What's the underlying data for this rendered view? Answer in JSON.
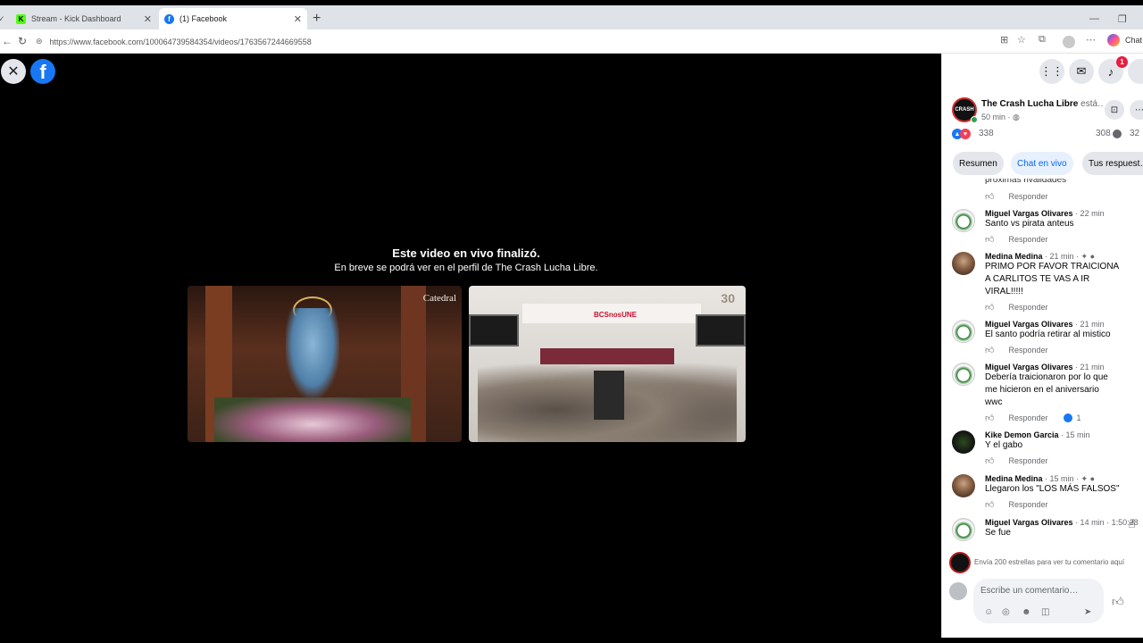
{
  "browser": {
    "tabs": [
      {
        "title": "Stream - Kick Dashboard",
        "active": false
      },
      {
        "title": "(1) Facebook",
        "active": true
      }
    ],
    "url": "https://www.facebook.com/100064739584354/videos/1763567244669558",
    "copilot_label": "Chat"
  },
  "video": {
    "ended_title": "Este video en vivo finalizó.",
    "ended_subtitle": "En breve se podrá ver en el perfil de The Crash Lucha Libre.",
    "thumb1_watermark": "Catedral",
    "thumb2_banner": "BCSnosUNE",
    "thumb2_anniv": "30"
  },
  "panel": {
    "notification_count": "1",
    "page_name": "The Crash Lucha Libre",
    "page_status": "está…",
    "page_time": "50 min · ",
    "reactions_count": "338",
    "comments_count": "308",
    "shares_count": "32",
    "tabs": [
      "Resumen",
      "Chat en vivo",
      "Tus respuest…"
    ],
    "active_tab": 1,
    "partial_top_text": "próximas rivalidades",
    "reply_label": "Responder",
    "comments": [
      {
        "name": "Miguel Vargas Olivares",
        "time": " · 22 min",
        "text": "Santo vs pirata anteus",
        "avatar": "miguel",
        "likes": ""
      },
      {
        "name": "Medina Medina",
        "time": " · 21 min · ",
        "text": "PRIMO POR FAVOR TRAICIONA A CARLITOS TE VAS A IR VIRAL!!!!!",
        "avatar": "medina",
        "likes": ""
      },
      {
        "name": "Miguel Vargas Olivares",
        "time": " · 21 min",
        "text": "El santo podría retirar al mistico",
        "avatar": "miguel",
        "likes": ""
      },
      {
        "name": "Miguel Vargas Olivares",
        "time": " · 21 min",
        "text": "Debería traicionaron por lo que me hicieron en el aniversario wwc",
        "avatar": "miguel",
        "likes": "1"
      },
      {
        "name": "Kike Demon Garcia",
        "time": " · 15 min",
        "text": "Y el gabo",
        "avatar": "kike",
        "likes": ""
      },
      {
        "name": "Medina Medina",
        "time": " · 15 min · ",
        "text": "Llegaron los \"LOS MÁS FALSOS\"",
        "avatar": "medina",
        "likes": ""
      },
      {
        "name": "Miguel Vargas Olivares",
        "time": " · 14 min · 1:50:28",
        "text": "Se fue",
        "avatar": "miguel",
        "likes": ""
      }
    ],
    "stars_prompt": "Envía 200 estrellas para ver tu comentario aquí",
    "comment_placeholder": "Escribe un comentario…"
  },
  "colors": {
    "fb_blue": "#1877f2",
    "active_tab_text": "#0866ff",
    "notification_red": "#e41e3f"
  }
}
